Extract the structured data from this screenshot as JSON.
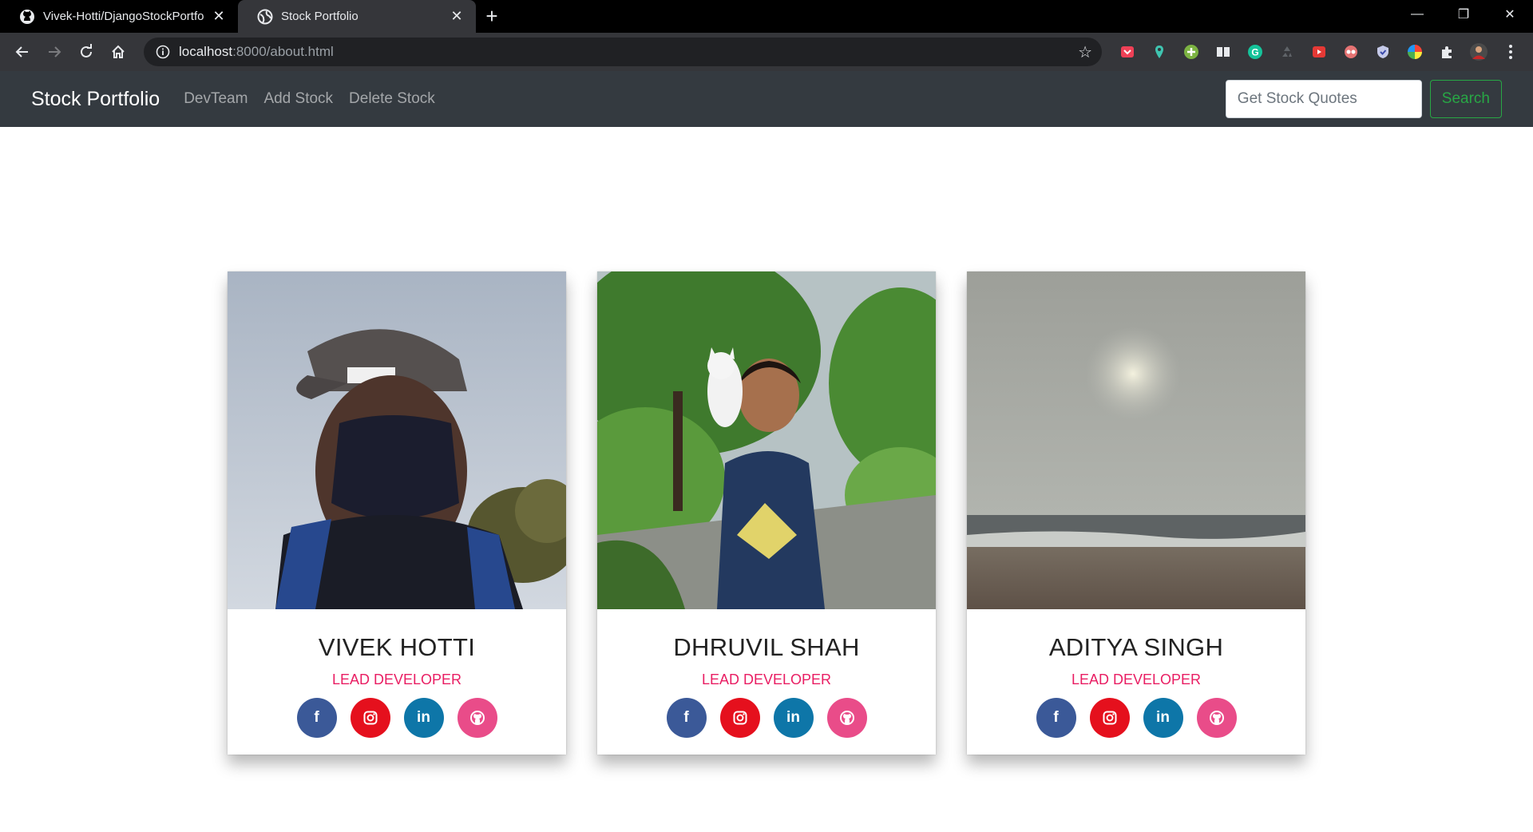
{
  "browser": {
    "tabs": [
      {
        "title": "Vivek-Hotti/DjangoStockPortfolio",
        "favicon": "github-icon",
        "active": false
      },
      {
        "title": "Stock Portfolio",
        "favicon": "globe-icon",
        "active": true
      }
    ],
    "url_host": "localhost",
    "url_path": ":8000/about.html"
  },
  "navbar": {
    "brand": "Stock Portfolio",
    "links": [
      "DevTeam",
      "Add Stock",
      "Delete Stock"
    ],
    "search_placeholder": "Get Stock Quotes",
    "search_button": "Search"
  },
  "team": [
    {
      "name": "VIVEK HOTTI",
      "role": "LEAD DEVELOPER"
    },
    {
      "name": "DHRUVIL SHAH",
      "role": "LEAD DEVELOPER"
    },
    {
      "name": "ADITYA SINGH",
      "role": "LEAD DEVELOPER"
    }
  ],
  "social_icons": [
    "facebook-icon",
    "instagram-icon",
    "linkedin-icon",
    "github-icon"
  ],
  "colors": {
    "navbar_bg": "#343a40",
    "role_text": "#e91e63",
    "search_button": "#28a745",
    "facebook": "#3b5998",
    "instagram": "#e5101d",
    "linkedin": "#0e76a8",
    "github": "#e94c89"
  }
}
